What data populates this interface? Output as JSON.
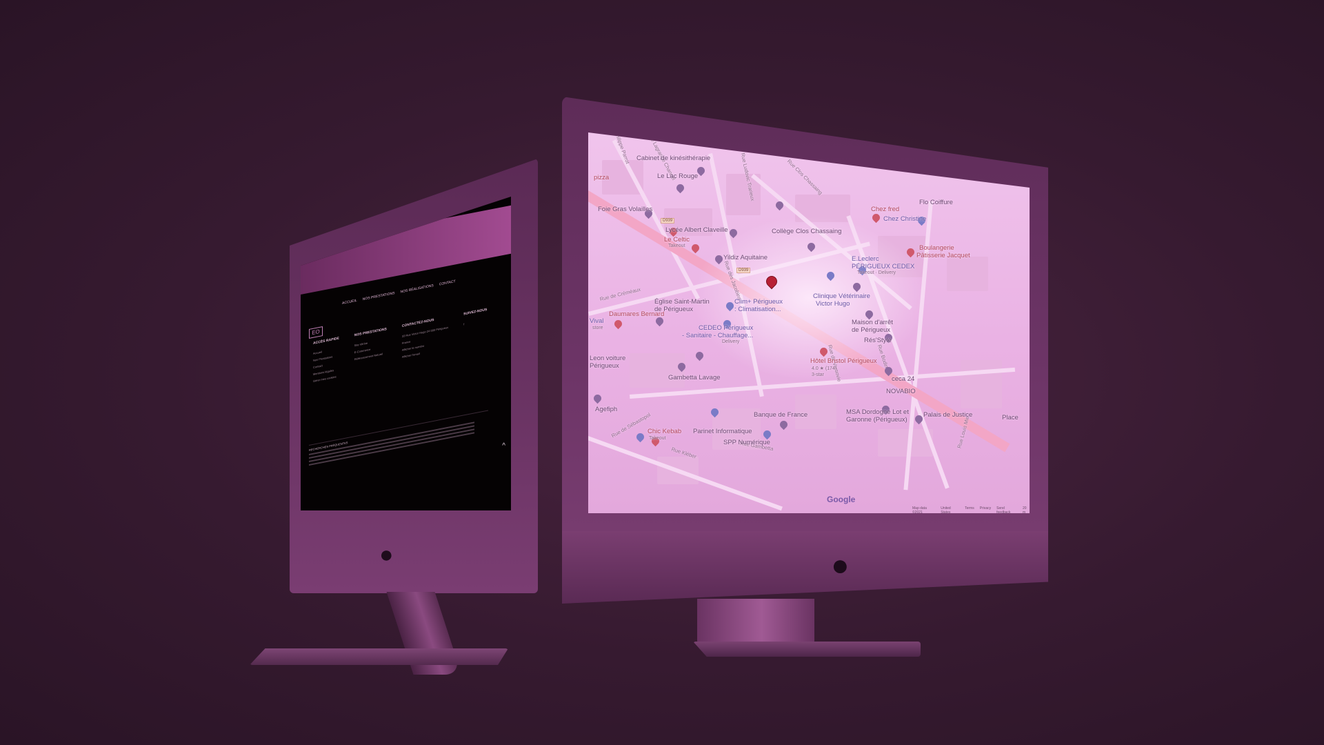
{
  "left_screen": {
    "nav": [
      "ACCUEIL",
      "NOS PRESTATIONS",
      "NOS RÉALISATIONS",
      "CONTACT"
    ],
    "columns": [
      {
        "heading": "ACCÈS RAPIDE",
        "items": [
          "Accueil",
          "Nos Prestations",
          "Contact",
          "Mentions légales",
          "Gérer mes cookies"
        ]
      },
      {
        "heading": "NOS PRESTATIONS",
        "items": [
          "Site Vitrine",
          "E-Commerce",
          "Référencement Naturel"
        ]
      },
      {
        "heading": "CONTACTEZ-NOUS",
        "items": [
          "33 Rue Victor Hugo 24 000 Périgueux",
          "France",
          "Afficher le numéro",
          "Afficher l'email"
        ]
      },
      {
        "heading": "SUIVEZ-NOUS",
        "items": [
          "f"
        ]
      }
    ],
    "footer_title": "RECHERCHES FRÉQUENTES",
    "scroll_top": "^"
  },
  "map": {
    "labels": [
      {
        "text": "Cabinet de kinésithérapie",
        "cls": ""
      },
      {
        "text": "Le Lac Rouge",
        "cls": ""
      },
      {
        "text": "Foie Gras Volailles",
        "cls": ""
      },
      {
        "text": "Lycée Albert Claveille",
        "cls": ""
      },
      {
        "text": "Le Celtic",
        "cls": "red"
      },
      {
        "text": "Takeout",
        "cls": "small"
      },
      {
        "text": "Yildiz Aquitaine",
        "cls": ""
      },
      {
        "text": "Collège Clos Chassaing",
        "cls": ""
      },
      {
        "text": "Église Saint-Martin",
        "cls": ""
      },
      {
        "text": "de Périgueux",
        "cls": ""
      },
      {
        "text": "Daumares Bernard",
        "cls": "red"
      },
      {
        "text": "Clim+ Périgueux",
        "cls": "purple"
      },
      {
        "text": ": Climatisation...",
        "cls": "purple"
      },
      {
        "text": "CEDEO Périgueux",
        "cls": "purple"
      },
      {
        "text": "- Sanitaire - Chauffage...",
        "cls": "purple"
      },
      {
        "text": "Delivery",
        "cls": "small"
      },
      {
        "text": "Gambetta Lavage",
        "cls": ""
      },
      {
        "text": "Agefiph",
        "cls": ""
      },
      {
        "text": "Chic Kebab",
        "cls": "red"
      },
      {
        "text": "Takeout",
        "cls": "small"
      },
      {
        "text": "Parinet Informatique",
        "cls": ""
      },
      {
        "text": "Banque de France",
        "cls": ""
      },
      {
        "text": "SPP Numérique",
        "cls": ""
      },
      {
        "text": "Clinique Vétérinaire",
        "cls": "purple"
      },
      {
        "text": "Victor Hugo",
        "cls": "purple"
      },
      {
        "text": "Maison d'arrêt",
        "cls": ""
      },
      {
        "text": "de Périgueux",
        "cls": ""
      },
      {
        "text": "Rés'Style",
        "cls": ""
      },
      {
        "text": "Hôtel Bristol Périgueux",
        "cls": "red"
      },
      {
        "text": "4.0 ★ (174)",
        "cls": "small"
      },
      {
        "text": "3-star",
        "cls": "small"
      },
      {
        "text": "E.Leclerc",
        "cls": "purple"
      },
      {
        "text": "PÉRIGUEUX CEDEX",
        "cls": "purple"
      },
      {
        "text": "Takeout · Delivery",
        "cls": "small"
      },
      {
        "text": "Boulangerie",
        "cls": "red"
      },
      {
        "text": "Pâtisserie Jacquet",
        "cls": "red"
      },
      {
        "text": "Chez Christine",
        "cls": "purple"
      },
      {
        "text": "Chez fred",
        "cls": "red"
      },
      {
        "text": "Flo Coiffure",
        "cls": ""
      },
      {
        "text": "ceca 24",
        "cls": ""
      },
      {
        "text": "NOVABIO",
        "cls": ""
      },
      {
        "text": "MSA Dordogne Lot et",
        "cls": ""
      },
      {
        "text": "Garonne (Périgueux)",
        "cls": ""
      },
      {
        "text": "Palais de Justice",
        "cls": ""
      },
      {
        "text": "Vival",
        "cls": "purple"
      },
      {
        "text": "store",
        "cls": "small"
      },
      {
        "text": "Leon voiture",
        "cls": ""
      },
      {
        "text": "Périgueux",
        "cls": ""
      },
      {
        "text": "pizza",
        "cls": "red"
      },
      {
        "text": "Place",
        "cls": ""
      }
    ],
    "streets": [
      "Rue Ludovic Trarieux",
      "Rue Philippe Parrot",
      "Rue Lagrange Chancel",
      "Rue Clos Chassaing",
      "Rue de Créméaux",
      "Rue des Jacobins",
      "Rue Kléber",
      "Rue Gambetta",
      "Rue de Varsovie",
      "Rue Louis Mie",
      "Rue de Sébastopol",
      "Rue Bodin"
    ],
    "road_badge": "D939",
    "google": "Google",
    "footer": [
      "Map data ©2021",
      "United States",
      "Terms",
      "Privacy",
      "Send feedback",
      "20 m"
    ]
  },
  "colors": {
    "background": "#361a30",
    "imac": "#6b3464",
    "map": "#eab2e4",
    "main_street": "#f3a6c6",
    "main_pin": "#b72035"
  }
}
